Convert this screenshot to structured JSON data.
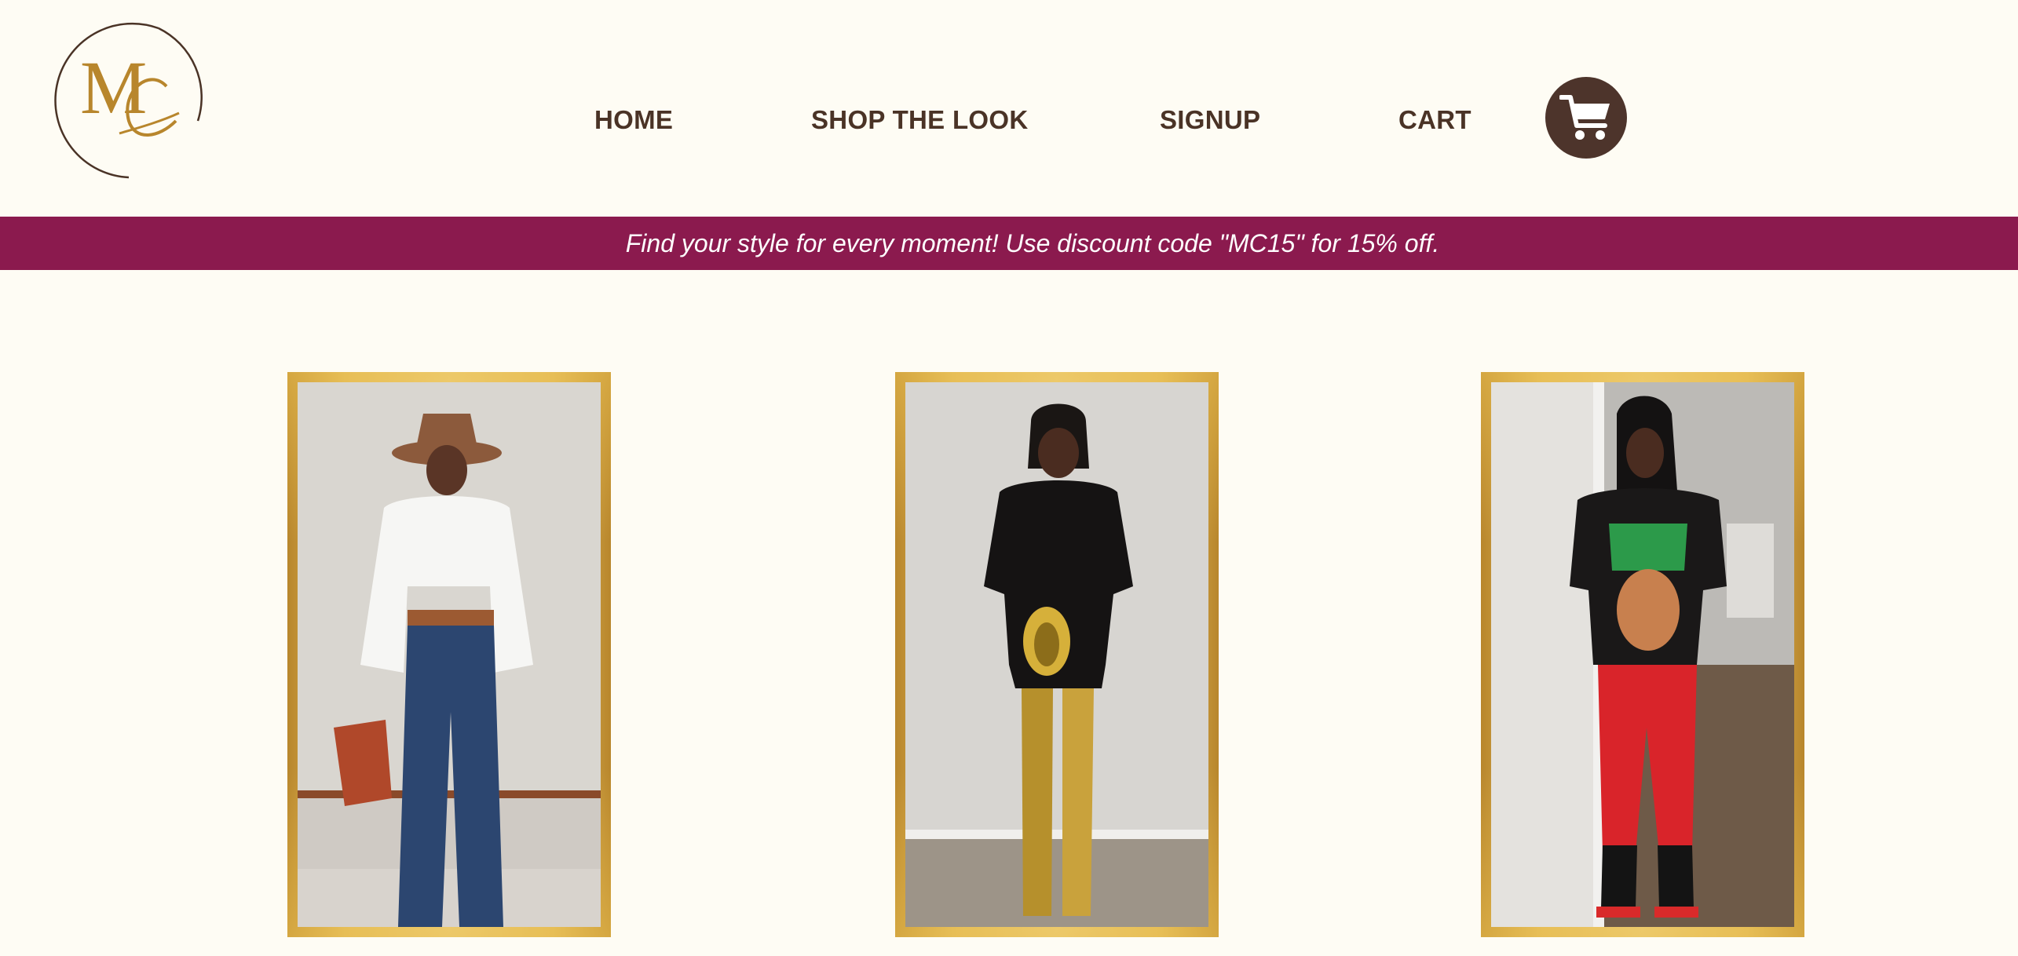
{
  "brand": {
    "logo_icon": "mc-monogram-logo",
    "colors": {
      "brown": "#4a3326",
      "gold": "#b8862c",
      "banner": "#8b1a4e",
      "background": "#fefcf4"
    }
  },
  "nav": {
    "home": "HOME",
    "shop_the_look": "SHOP THE LOOK",
    "signup": "SIGNUP",
    "cart": "CART",
    "cart_icon": "shopping-cart-icon"
  },
  "banner": {
    "text": "Find your style for every moment! Use discount code \"MC15\" for 15% off."
  },
  "looks": [
    {
      "icon": "outfit-photo",
      "frame": "gold"
    },
    {
      "icon": "outfit-photo",
      "frame": "gold"
    },
    {
      "icon": "outfit-photo",
      "frame": "gold"
    }
  ]
}
